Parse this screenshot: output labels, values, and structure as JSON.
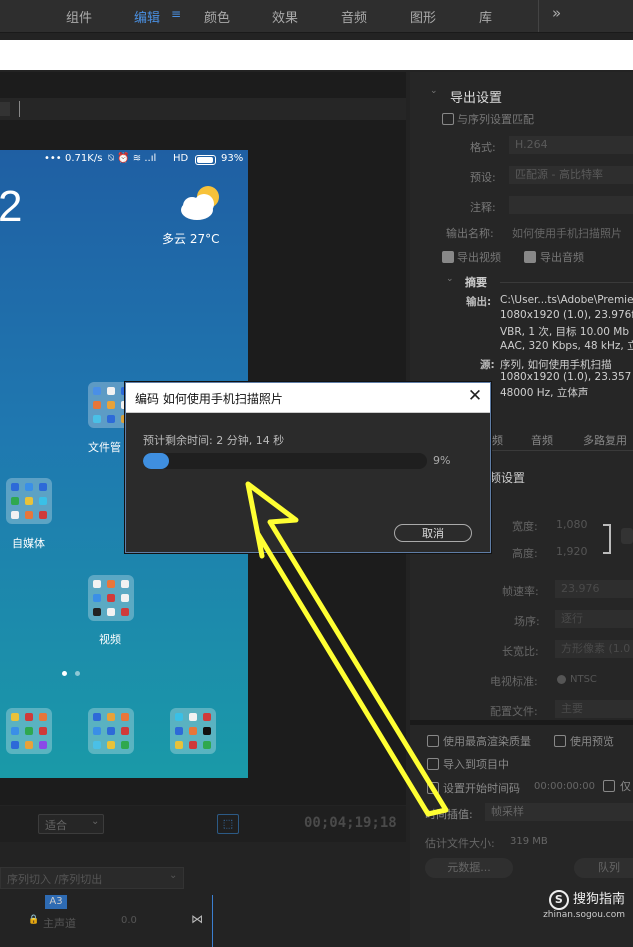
{
  "topnav": {
    "items": [
      {
        "label": "组件"
      },
      {
        "label": "编辑"
      },
      {
        "label": "颜色"
      },
      {
        "label": "效果"
      },
      {
        "label": "音频"
      },
      {
        "label": "图形"
      },
      {
        "label": "库"
      }
    ],
    "more_label": "»"
  },
  "phone": {
    "status_text": "0.71K/s",
    "network": "HD",
    "battery": "93%",
    "clock_partial": "2",
    "weather": "多云  27°C",
    "apps": {
      "file_manager": "文件管",
      "self_media": "自媒体",
      "video": "视频"
    }
  },
  "monitor": {
    "fit_label": "适合",
    "timecode": "00;04;19;18",
    "sequence_label": "序列切入 /序列切出"
  },
  "timeline": {
    "track_label": "A3",
    "master_label": "主声道",
    "master_value": "0.0"
  },
  "export": {
    "section_title": "导出设置",
    "match_sequence": "与序列设置匹配",
    "format_label": "格式:",
    "format_value": "H.264",
    "preset_label": "预设:",
    "preset_value": "匹配源 - 高比特率",
    "comment_label": "注释:",
    "output_name_label": "输出名称:",
    "output_name_value": "如何使用手机扫描照片",
    "export_video": "导出视频",
    "export_audio": "导出音频",
    "summary_title": "摘要",
    "output_key": "输出:",
    "output_lines": [
      "C:\\User...ts\\Adobe\\Premie",
      "1080x1920 (1.0), 23.976f",
      "VBR, 1 次, 目标 10.00 Mb",
      "AAC, 320 Kbps, 48 kHz, 立"
    ],
    "source_key": "源:",
    "source_lines": [
      "序列, 如何使用手机扫描",
      "1080x1920 (1.0), 23.357 f",
      "48000 Hz, 立体声"
    ],
    "tabs": [
      "频",
      "音频",
      "多路复用"
    ],
    "video_settings_title": "频设置",
    "width_label": "宽度:",
    "width_value": "1,080",
    "height_label": "高度:",
    "height_value": "1,920",
    "framerate_label": "帧速率:",
    "framerate_value": "23.976",
    "field_order_label": "场序:",
    "field_order_value": "逐行",
    "aspect_label": "长宽比:",
    "aspect_value": "方形像素 (1.0",
    "tv_standard_label": "电视标准:",
    "tv_standard_value": "NTSC",
    "profile_label": "配置文件:",
    "profile_value": "主要",
    "max_render_quality": "使用最高渲染质量",
    "use_previews": "使用预览",
    "import_into_project": "导入到项目中",
    "set_start_timecode": "设置开始时间码",
    "start_timecode_value": "00:00:00:00",
    "only_label": "仅",
    "time_interp_label": "时间插值:",
    "time_interp_value": "帧采样",
    "file_size_label": "估计文件大小:",
    "file_size_value": "319 MB",
    "metadata_button": "元数据...",
    "queue_button": "队列"
  },
  "dialog": {
    "title": "编码 如何使用手机扫描照片",
    "remaining_text": "预计剩余时间: 2 分钟, 14 秒",
    "progress": 0.09,
    "progress_label": "9%",
    "cancel_label": "取消"
  },
  "watermark": {
    "brand": "搜狗指南",
    "url": "zhinan.sogou.com"
  },
  "colors": {
    "accent": "#4a90e2",
    "annotation_arrow": "#ffff33",
    "progress": "#3f8fe0"
  }
}
